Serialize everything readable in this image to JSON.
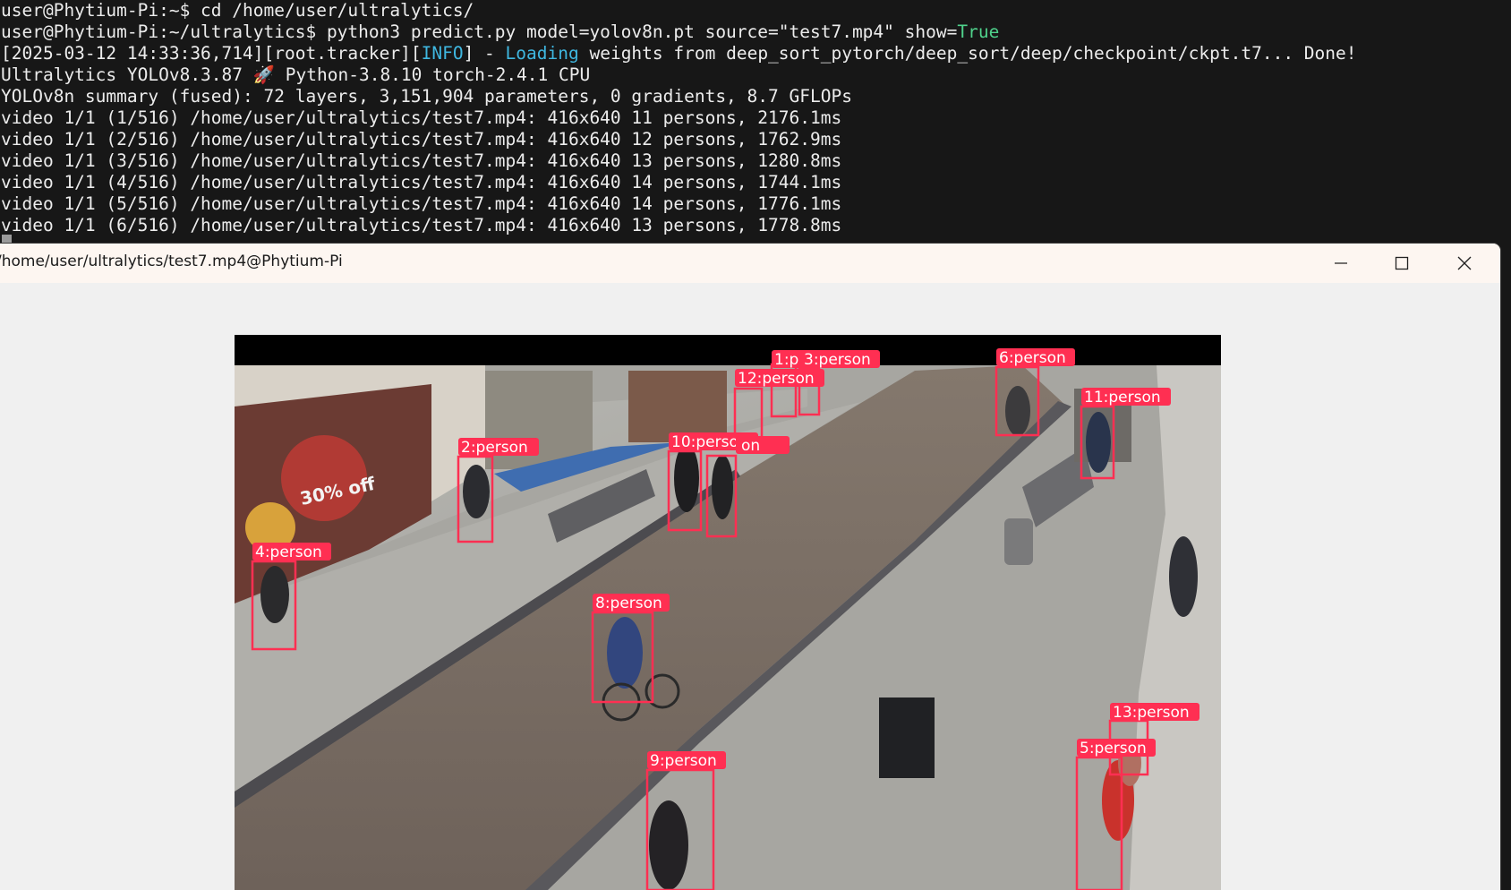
{
  "terminal": {
    "lines": [
      {
        "id": "l0",
        "text": "user@Phytium-Pi:~$ cd /home/user/ultralytics/"
      },
      {
        "id": "l1",
        "text": "user@Phytium-Pi:~/ultralytics$ python3 predict.py model=yolov8n.pt source=\"test7.mp4\" show=",
        "accent": "True"
      },
      {
        "id": "l2",
        "pre": "[2025-03-12 14:33:36,714][root.tracker][",
        "info": "INFO",
        "mid": "] - ",
        "loading": "Loading",
        "post": " weights from deep_sort_pytorch/deep_sort/deep/checkpoint/ckpt.t7... Done!"
      },
      {
        "id": "l3",
        "text": "Ultralytics YOLOv8.3.87 🚀 Python-3.8.10 torch-2.4.1 CPU"
      },
      {
        "id": "l4",
        "text": "YOLOv8n summary (fused): 72 layers, 3,151,904 parameters, 0 gradients, 8.7 GFLOPs"
      },
      {
        "id": "l5",
        "text": "video 1/1 (1/516) /home/user/ultralytics/test7.mp4: 416x640 11 persons, 2176.1ms"
      },
      {
        "id": "l6",
        "text": "video 1/1 (2/516) /home/user/ultralytics/test7.mp4: 416x640 12 persons, 1762.9ms"
      },
      {
        "id": "l7",
        "text": "video 1/1 (3/516) /home/user/ultralytics/test7.mp4: 416x640 13 persons, 1280.8ms"
      },
      {
        "id": "l8",
        "text": "video 1/1 (4/516) /home/user/ultralytics/test7.mp4: 416x640 14 persons, 1744.1ms"
      },
      {
        "id": "l9",
        "text": "video 1/1 (5/516) /home/user/ultralytics/test7.mp4: 416x640 14 persons, 1776.1ms"
      },
      {
        "id": "l10",
        "text": "video 1/1 (6/516) /home/user/ultralytics/test7.mp4: 416x640 13 persons, 1778.8ms"
      }
    ]
  },
  "window": {
    "title": "/home/user/ultralytics/test7.mp4@Phytium-Pi",
    "controls": {
      "minimize": "minimize-icon",
      "maximize": "maximize-icon",
      "close": "close-icon"
    }
  },
  "detections": [
    {
      "label": "1:p"
    },
    {
      "label": "3:person"
    },
    {
      "label": "12:person"
    },
    {
      "label": "6:person"
    },
    {
      "label": "11:person"
    },
    {
      "label": "2:person"
    },
    {
      "label": "10:person"
    },
    {
      "label": "on"
    },
    {
      "label": "4:person"
    },
    {
      "label": "8:person"
    },
    {
      "label": "13:person"
    },
    {
      "label": "5:person"
    },
    {
      "label": "9:person"
    }
  ],
  "scene_text": {
    "shop_sign": "30% off"
  },
  "colors": {
    "box": "#ff2f52",
    "terminal_bg": "#171717",
    "accent_green": "#4fd18b",
    "accent_cyan": "#3fb7e0"
  }
}
